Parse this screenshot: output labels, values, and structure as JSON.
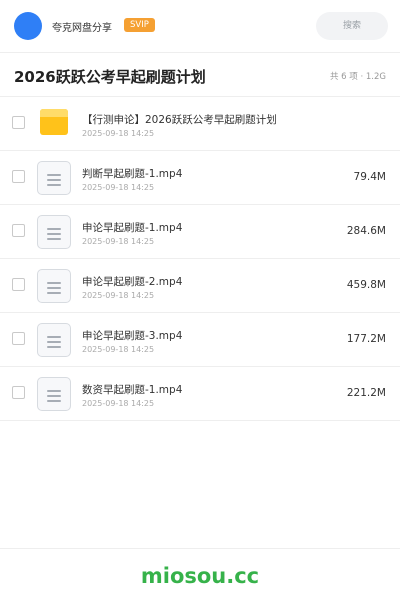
{
  "header": {
    "app_name": "夸克网盘分享",
    "badge": "SVIP",
    "search_placeholder": "搜索",
    "avatar_color": "#2f7ff6"
  },
  "share": {
    "title": "2026跃跃公考早起刷题计划",
    "meta": "共 6 项 · 1.2G"
  },
  "files": [
    {
      "type": "folder",
      "icon": "folder-icon",
      "name": "【行测申论】2026跃跃公考早起刷题计划",
      "date": "2025-09-18 14:25",
      "size": ""
    },
    {
      "type": "file",
      "icon": "file-icon",
      "name": "判断早起刷题-1.mp4",
      "date": "2025-09-18 14:25",
      "size": "79.4M"
    },
    {
      "type": "file",
      "icon": "file-icon",
      "name": "申论早起刷题-1.mp4",
      "date": "2025-09-18 14:25",
      "size": "284.6M"
    },
    {
      "type": "file",
      "icon": "file-icon",
      "name": "申论早起刷题-2.mp4",
      "date": "2025-09-18 14:25",
      "size": "459.8M"
    },
    {
      "type": "file",
      "icon": "file-icon",
      "name": "申论早起刷题-3.mp4",
      "date": "2025-09-18 14:25",
      "size": "177.2M"
    },
    {
      "type": "file",
      "icon": "file-icon",
      "name": "数资早起刷题-1.mp4",
      "date": "2025-09-18 14:25",
      "size": "221.2M"
    }
  ],
  "footer": {
    "watermark": "miosou.cc",
    "watermark_color": "#36b24a"
  }
}
